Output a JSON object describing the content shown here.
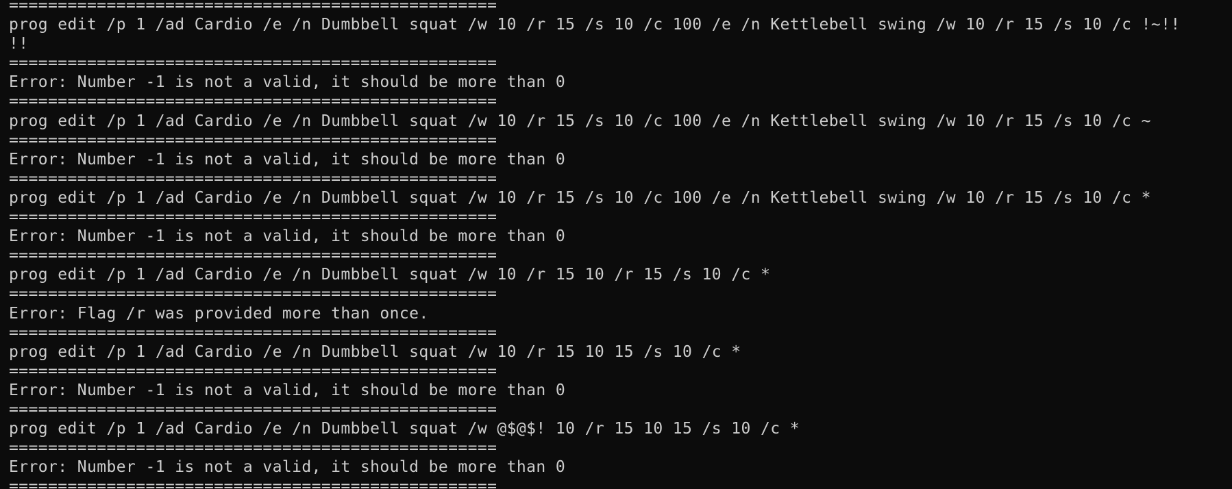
{
  "terminal": {
    "colors": {
      "background": "#0c0c0c",
      "foreground": "#cccccc"
    },
    "lines": [
      "==================================================",
      "prog edit /p 1 /ad Cardio /e /n Dumbbell squat /w 10 /r 15 /s 10 /c 100 /e /n Kettlebell swing /w 10 /r 15 /s 10 /c !~!!",
      "!!",
      "==================================================",
      "Error: Number -1 is not a valid, it should be more than 0",
      "==================================================",
      "prog edit /p 1 /ad Cardio /e /n Dumbbell squat /w 10 /r 15 /s 10 /c 100 /e /n Kettlebell swing /w 10 /r 15 /s 10 /c ~",
      "==================================================",
      "Error: Number -1 is not a valid, it should be more than 0",
      "==================================================",
      "prog edit /p 1 /ad Cardio /e /n Dumbbell squat /w 10 /r 15 /s 10 /c 100 /e /n Kettlebell swing /w 10 /r 15 /s 10 /c *",
      "==================================================",
      "Error: Number -1 is not a valid, it should be more than 0",
      "==================================================",
      "prog edit /p 1 /ad Cardio /e /n Dumbbell squat /w 10 /r 15 10 /r 15 /s 10 /c *",
      "==================================================",
      "Error: Flag /r was provided more than once.",
      "==================================================",
      "prog edit /p 1 /ad Cardio /e /n Dumbbell squat /w 10 /r 15 10 15 /s 10 /c *",
      "==================================================",
      "Error: Number -1 is not a valid, it should be more than 0",
      "==================================================",
      "prog edit /p 1 /ad Cardio /e /n Dumbbell squat /w @$@$! 10 /r 15 10 15 /s 10 /c *",
      "==================================================",
      "Error: Number -1 is not a valid, it should be more than 0",
      "=================================================="
    ]
  }
}
